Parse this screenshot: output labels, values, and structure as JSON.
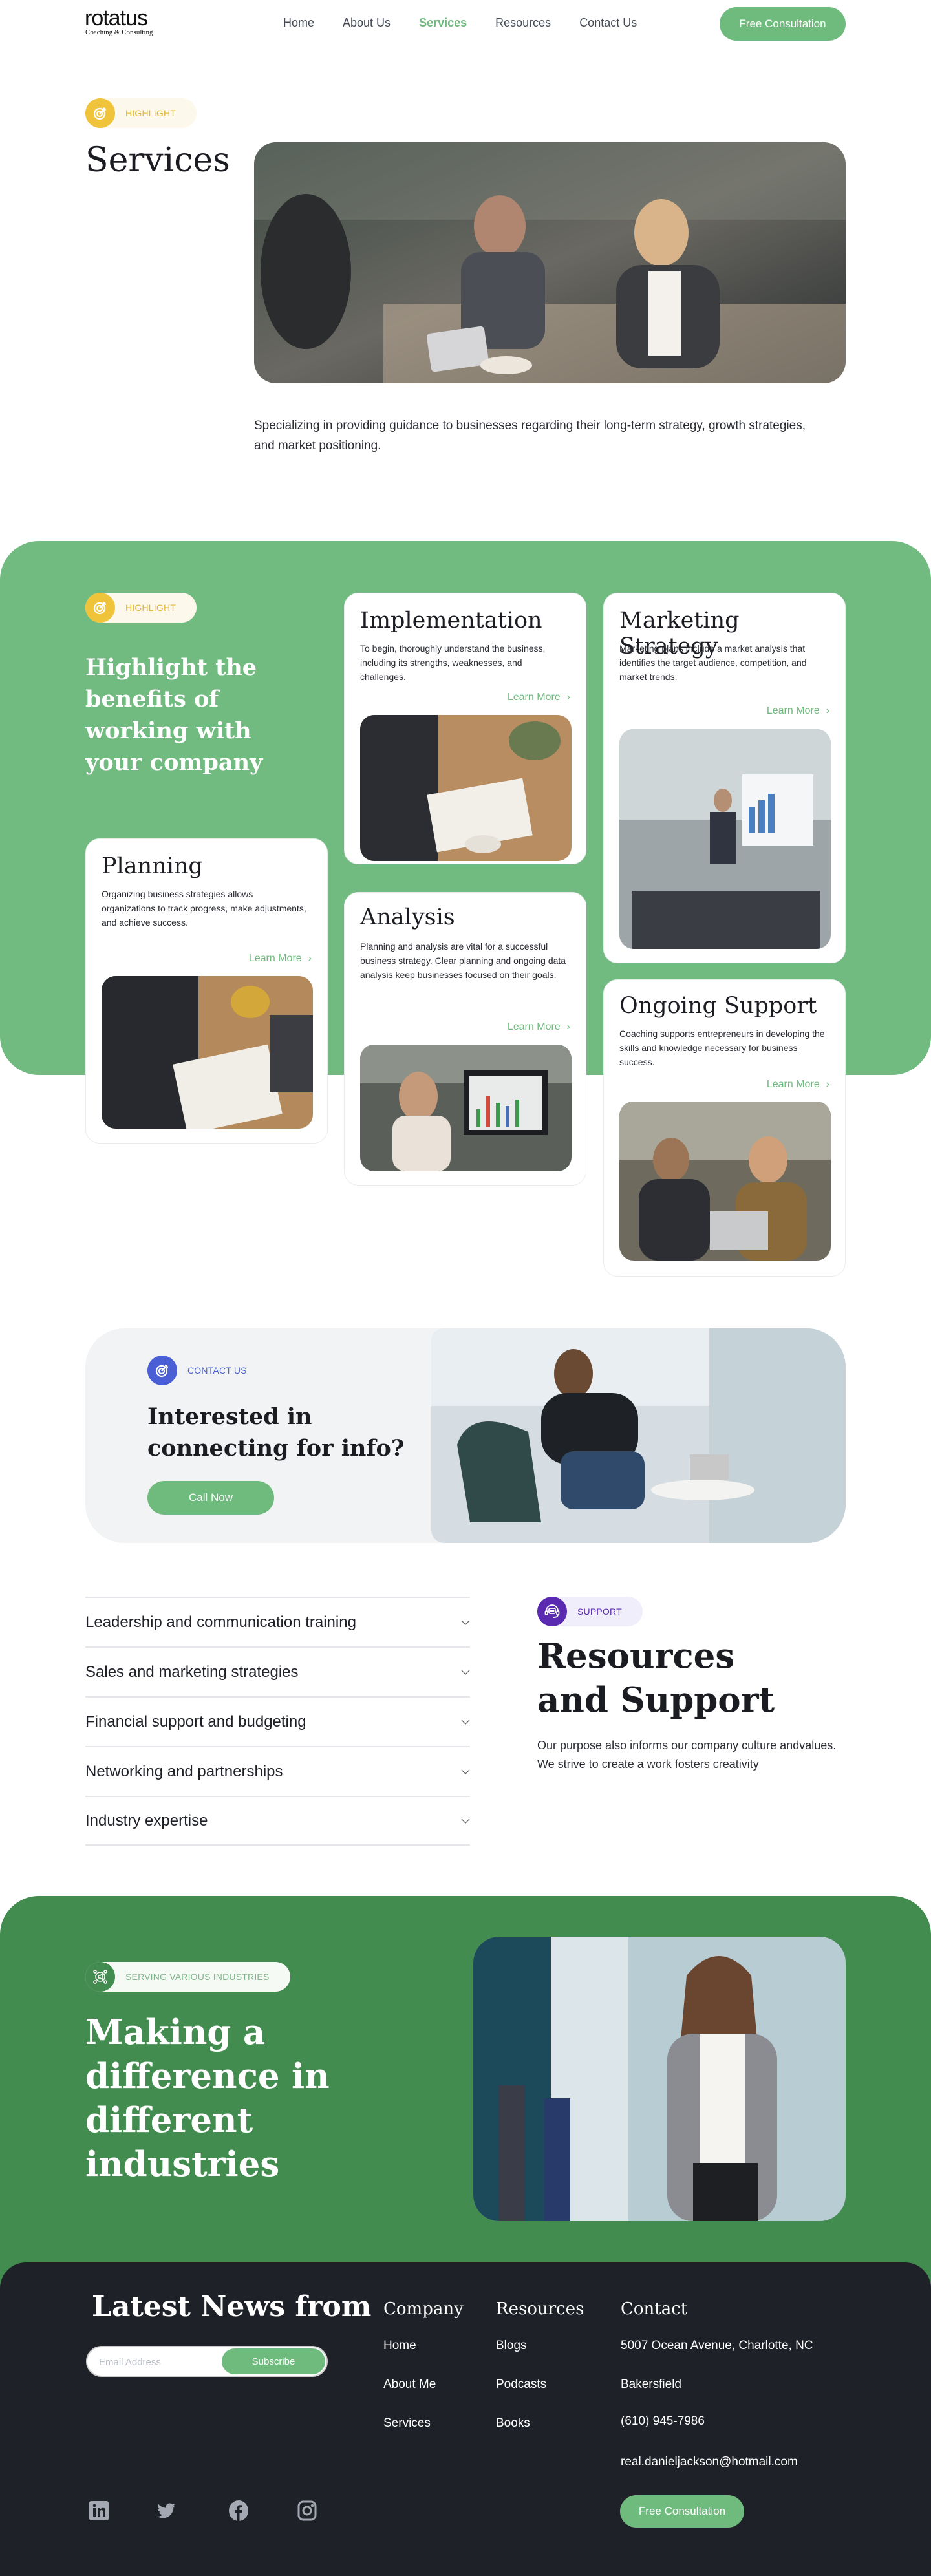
{
  "nav": {
    "logo": "rotatus",
    "logo_tagline": "Coaching & Consulting",
    "links": [
      {
        "label": "Home",
        "active": false
      },
      {
        "label": "About Us",
        "active": false
      },
      {
        "label": "Services",
        "active": true
      },
      {
        "label": "Resources",
        "active": false
      },
      {
        "label": "Contact Us",
        "active": false
      }
    ],
    "cta": "Free Consultation"
  },
  "colors": {
    "primary_green": "#6fbb7e",
    "section_green": "#71ba80",
    "dark_green": "#438c50",
    "highlight_yellow": "#f0c43a",
    "contact_blue": "#4a5fd6",
    "support_purple": "#5a2bb0",
    "footer_dark": "#1f2128"
  },
  "hero": {
    "badge": "HIGHLIGHT",
    "badge_icon": "target-icon",
    "title": "Services",
    "image_alt": "Team working on laptops in office",
    "description": "Specializing in providing guidance to businesses regarding their long-term strategy, growth strategies, and market positioning."
  },
  "benefits": {
    "badge": "HIGHLIGHT",
    "title": "Highlight the benefits of working with your company",
    "learn_more": "Learn More",
    "cards": [
      {
        "title": "Implementation",
        "text": "To begin, thoroughly understand the business, including its strengths, weaknesses, and challenges.",
        "image_alt": "Person writing notes at desk"
      },
      {
        "title": "Marketing Strategy",
        "text": "Marketing plans include a market analysis that identifies the target audience, competition, and market trends.",
        "image_alt": "Team meeting with presentation chart"
      },
      {
        "title": "Planning",
        "text": "Organizing business strategies allows organizations to track progress, make adjustments, and achieve success.",
        "image_alt": "Businessman writing plans"
      },
      {
        "title": "Analysis",
        "text": "Planning and analysis are vital for a successful business strategy. Clear planning and ongoing data analysis keep businesses focused on their goals.",
        "image_alt": "Woman analyzing charts on monitors"
      },
      {
        "title": "Ongoing Support",
        "text": "Coaching supports entrepreneurs in developing the skills and knowledge necessary for business success.",
        "image_alt": "Two people discussing at laptop"
      }
    ]
  },
  "contact": {
    "badge": "CONTACT US",
    "title": "Interested in connecting for info?",
    "button": "Call Now",
    "image_alt": "Woman working on laptop at table"
  },
  "resources": {
    "accordion": [
      "Leadership and communication training",
      "Sales and marketing strategies",
      "Financial support and budgeting",
      "Networking and partnerships",
      "Industry expertise"
    ],
    "badge": "SUPPORT",
    "title_line1": "Resources",
    "title_line2": "and Support",
    "description": "Our purpose also informs our company culture andvalues. We strive to create a work fosters creativity"
  },
  "industries": {
    "badge": "SERVING VARIOUS INDUSTRIES",
    "title": "Making a difference in different industries",
    "image_alt": "Businesswoman walking in office"
  },
  "footer": {
    "news_title": "Latest News from",
    "email_placeholder": "Email Address",
    "email_value": "",
    "subscribe": "Subscribe",
    "columns": {
      "company": {
        "heading": "Company",
        "links": [
          "Home",
          "About Me",
          "Services"
        ]
      },
      "resources": {
        "heading": "Resources",
        "links": [
          "Blogs",
          "Podcasts",
          "Books"
        ]
      },
      "contact": {
        "heading": "Contact",
        "items": [
          "5007 Ocean Avenue, Charlotte, NC",
          "Bakersfield",
          "(610) 945-7986",
          "real.danieljackson@hotmail.com"
        ]
      }
    },
    "social": [
      "linkedin-icon",
      "twitter-icon",
      "facebook-icon",
      "instagram-icon"
    ],
    "cta": "Free Consultation"
  }
}
